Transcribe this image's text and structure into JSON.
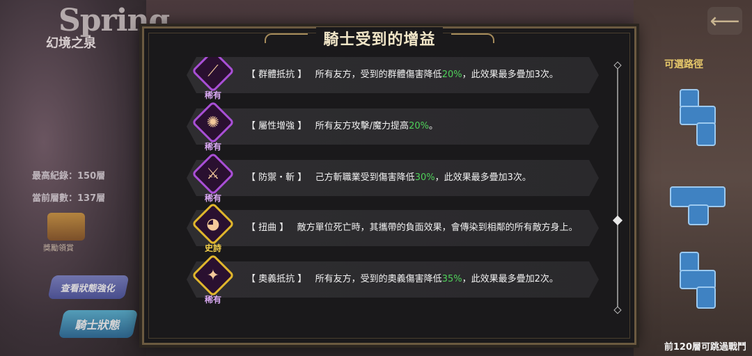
{
  "background": {
    "logo": "Spring",
    "subtitle": "幻境之泉",
    "record_label": "最高紀錄：",
    "record_value": "150層",
    "current_label": "當前層數：",
    "current_value": "137層",
    "chest_label": "獎勵領賞",
    "btn_view_buffs": "查看狀態強化",
    "btn_knight_status": "騎士狀態",
    "path_title": "可選路徑",
    "bottom_note": "前120層可跳過戰鬥",
    "back_icon": "back-arrow-icon"
  },
  "panel": {
    "title": "騎士受到的增益"
  },
  "buffs": [
    {
      "tag": "【 群體抵抗 】",
      "pre": "所有友方，受到的群體傷害降低",
      "hl": "20%",
      "post": "，此效果最多疊加3次。",
      "rarity": "稀有",
      "tier": "rare",
      "icon": "claw-icon",
      "glyph": "⟋"
    },
    {
      "tag": "【 屬性增強 】",
      "pre": "所有友方攻擊/魔力提高",
      "hl": "20%",
      "post": "。",
      "rarity": "稀有",
      "tier": "rare",
      "icon": "orbit-icon",
      "glyph": "✺"
    },
    {
      "tag": "【 防禦・斬 】",
      "pre": "己方斬職業受到傷害降低",
      "hl": "30%",
      "post": "，此效果最多疊加3次。",
      "rarity": "稀有",
      "tier": "rare",
      "icon": "blade-icon",
      "glyph": "⚔"
    },
    {
      "tag": "【 扭曲 】",
      "pre": "敵方單位死亡時，其攜帶的負面效果，會傳染到相鄰的所有敵方身上。",
      "hl": "",
      "post": "",
      "rarity": "史詩",
      "tier": "epic",
      "icon": "twist-icon",
      "glyph": "◕"
    },
    {
      "tag": "【 奧義抵抗 】",
      "pre": "所有友方，受到的奧義傷害降低",
      "hl": "35%",
      "post": "，此效果最多疊加2次。",
      "rarity": "稀有",
      "tier": "rare",
      "icon": "star-orb-icon",
      "glyph": "✦"
    }
  ]
}
